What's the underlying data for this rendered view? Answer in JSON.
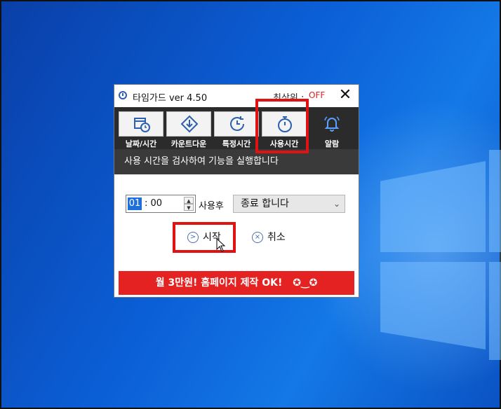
{
  "window": {
    "title": "타임가드 ver 4.50",
    "top_label": "최상위 :",
    "top_state": "OFF",
    "close_glyph": "✕"
  },
  "toolbar": {
    "items": [
      {
        "label": "날짜/시간",
        "icon": "calendar-clock-icon"
      },
      {
        "label": "카운트다운",
        "icon": "countdown-arrow-icon"
      },
      {
        "label": "특정시간",
        "icon": "clock-refresh-icon"
      },
      {
        "label": "사용시간",
        "icon": "stopwatch-icon"
      },
      {
        "label": "알람",
        "icon": "bell-icon"
      }
    ]
  },
  "banner": {
    "text": "사용 시간을 검사하여 기능을 실행합니다"
  },
  "timer": {
    "hours": "01",
    "rest": ": 00",
    "after_label": "사용후"
  },
  "action_select": {
    "value": "종료 합니다"
  },
  "buttons": {
    "start": "시작",
    "cancel": "취소"
  },
  "ad": {
    "text": "월 3만원! 홈페이지 제작 OK!",
    "emoticon": "✪‿✪"
  },
  "colors": {
    "highlight": "#e11212",
    "ad_bg": "#e52222",
    "toolbar_bg": "#2b2b2b",
    "off": "#e02020"
  }
}
